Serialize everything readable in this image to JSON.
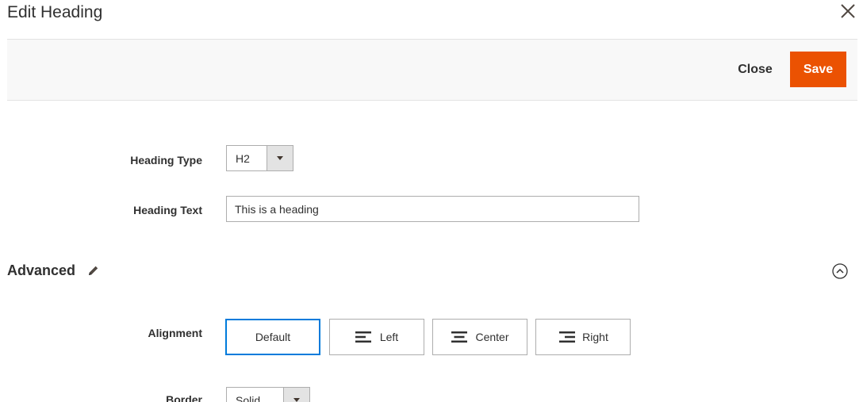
{
  "modal": {
    "title": "Edit Heading"
  },
  "actions": {
    "close_label": "Close",
    "save_label": "Save"
  },
  "form": {
    "heading_type": {
      "label": "Heading Type",
      "value": "H2"
    },
    "heading_text": {
      "label": "Heading Text",
      "value": "This is a heading"
    }
  },
  "advanced": {
    "title": "Advanced",
    "alignment": {
      "label": "Alignment",
      "options": [
        {
          "label": "Default",
          "selected": true
        },
        {
          "label": "Left",
          "icon": "align-left-icon"
        },
        {
          "label": "Center",
          "icon": "align-center-icon"
        },
        {
          "label": "Right",
          "icon": "align-right-icon"
        }
      ]
    },
    "border": {
      "label": "Border",
      "value": "Solid"
    }
  },
  "colors": {
    "primary_accent": "#eb5202",
    "selected_outline": "#007bdb",
    "action_bar_bg": "#f8f8f8"
  }
}
